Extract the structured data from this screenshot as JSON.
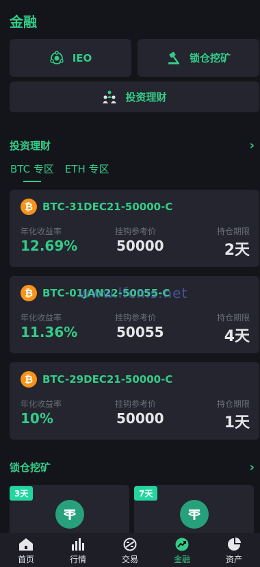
{
  "header": {
    "title": "金融"
  },
  "tiles": {
    "ieo": {
      "label": "IEO",
      "icon": "ieo-orbit-icon"
    },
    "lock_mining": {
      "label": "锁仓挖矿",
      "icon": "pickaxe-icon"
    },
    "investment": {
      "label": "投资理财",
      "icon": "investment-people-icon"
    }
  },
  "investment_section": {
    "title": "投资理财",
    "tabs": [
      "BTC 专区",
      "ETH 专区"
    ],
    "active_tab": 0,
    "column_labels": {
      "annual_yield": "年化收益率",
      "ref_price": "挂钩参考价",
      "term": "持仓期限"
    },
    "products": [
      {
        "name": "BTC-31DEC21-50000-C",
        "annual_yield": "12.69%",
        "ref_price": "50000",
        "term": "2天"
      },
      {
        "name": "BTC-01JAN22-50055-C",
        "annual_yield": "11.36%",
        "ref_price": "50055",
        "term": "4天"
      },
      {
        "name": "BTC-29DEC21-50000-C",
        "annual_yield": "10%",
        "ref_price": "50000",
        "term": "1天"
      }
    ]
  },
  "lock_mining_section": {
    "title": "锁仓挖矿",
    "items": [
      {
        "badge": "3天",
        "icon": "tether-icon"
      },
      {
        "badge": "7天",
        "icon": "tether-icon"
      }
    ]
  },
  "watermark": "www.lfcms.net",
  "tabbar": [
    {
      "label": "首页",
      "icon": "home-icon"
    },
    {
      "label": "行情",
      "icon": "market-bars-icon"
    },
    {
      "label": "交易",
      "icon": "trade-icon"
    },
    {
      "label": "金融",
      "icon": "finance-trend-icon",
      "active": true
    },
    {
      "label": "资产",
      "icon": "assets-pie-icon"
    }
  ],
  "colors": {
    "accent": "#33cc88",
    "background": "#14151b",
    "card": "#24252e",
    "bitcoin": "#f7931a",
    "tether": "#26a17b"
  }
}
